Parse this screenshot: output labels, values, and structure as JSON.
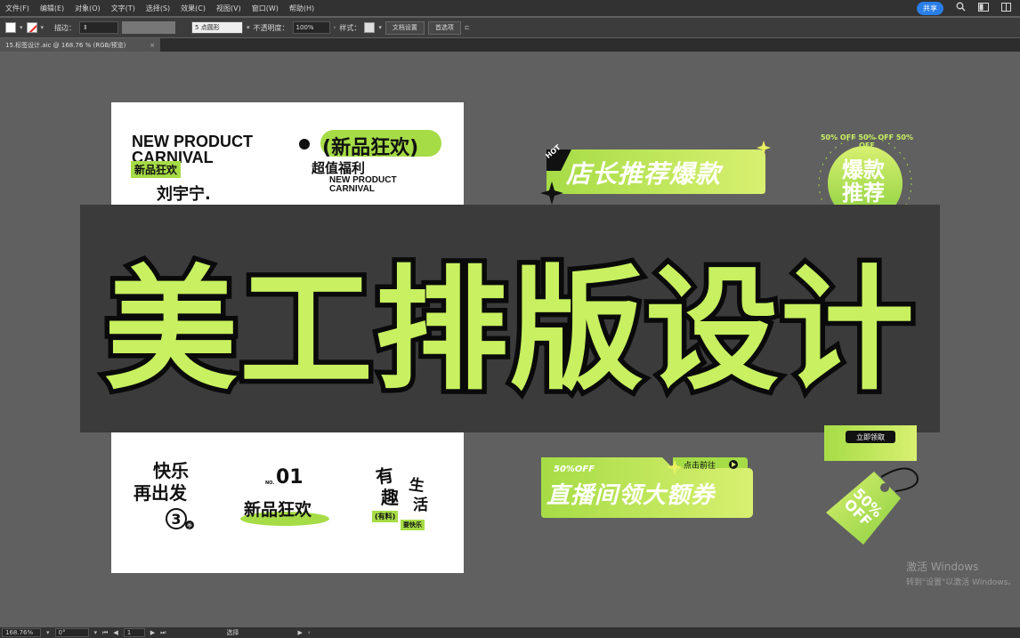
{
  "menubar": {
    "items": [
      "文件(F)",
      "编辑(E)",
      "对象(O)",
      "文字(T)",
      "选择(S)",
      "效果(C)",
      "视图(V)",
      "窗口(W)",
      "帮助(H)"
    ],
    "share": "共享"
  },
  "control": {
    "stroke_label": "描边：",
    "brush": "5 点圆形",
    "opacity_label": "不透明度：",
    "opacity": "100%",
    "style_label": "样式：",
    "doc_setup": "文档设置",
    "preferences": "首选项"
  },
  "tab": {
    "name": "15.标签设计.aic @ 168.76 % (RGB/预览)"
  },
  "title": "美工排版设计",
  "artwork": {
    "np_line1": "NEW PRODUCT",
    "np_line2": "CARNIVAL",
    "np_tag": "新品狂欢",
    "np_name": "刘宇宁.",
    "carnival_cn": "新品狂欢",
    "carnival_sub": "超值福利",
    "carnival_en1": "NEW PRODUCT",
    "carnival_en2": "CARNIVAL",
    "hot_badge": "HOT",
    "shop_banner": "店长推荐爆款",
    "circle_text": "爆款推荐",
    "circle_ring": "50% OFF 50% OFF 50% OFF",
    "claim_btn": "立即领取",
    "happy_l1": "快乐",
    "happy_l2": "再出发",
    "happy_num": "3",
    "happy_small": "季",
    "no_label": "NO.",
    "no_num": "01",
    "no_text": "新品狂欢",
    "fun_1": "有",
    "fun_2": "趣",
    "fun_3": "生",
    "fun_4": "活",
    "fun_tag": "(有料)",
    "fun_sub": "要快乐",
    "live_off": "50%OFF",
    "live_go": "点击前往",
    "live_main": "直播间领大额券",
    "tag_off1": "50%",
    "tag_off2": "OFF"
  },
  "status": {
    "zoom": "168.76%",
    "angle": "0°",
    "page": "1",
    "tool": "选择"
  },
  "watermark": {
    "line1": "激活 Windows",
    "line2": "转到\"设置\"以激活 Windows。"
  }
}
